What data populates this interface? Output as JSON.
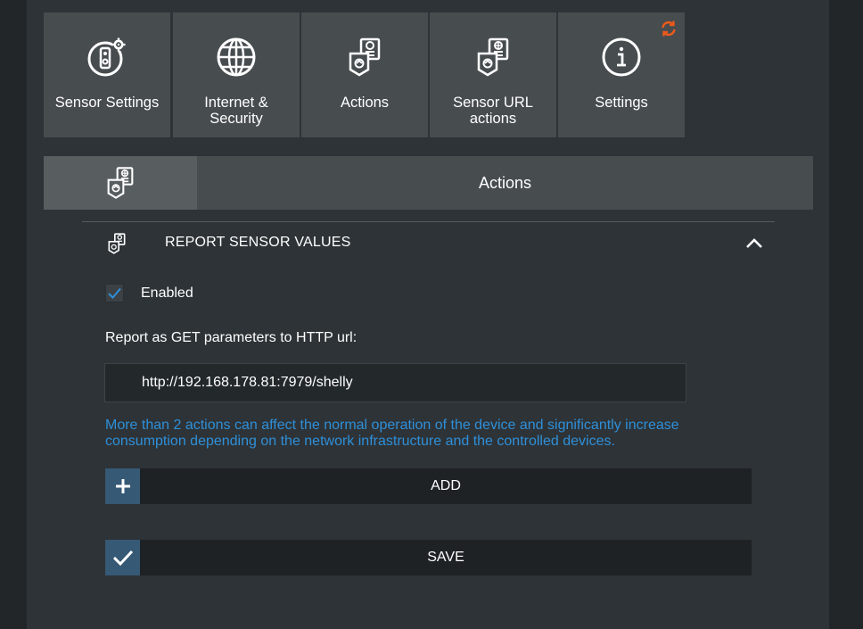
{
  "nav_tiles": [
    {
      "label": "Sensor Settings",
      "icon": "sensor-gear-icon"
    },
    {
      "label": "Internet & Security",
      "icon": "globe-icon"
    },
    {
      "label": "Actions",
      "icon": "actions-icon"
    },
    {
      "label": "Sensor URL actions",
      "icon": "sensor-url-actions-icon"
    },
    {
      "label": "Settings",
      "icon": "info-icon",
      "badge_icon": "refresh-icon"
    }
  ],
  "header": {
    "title": "Actions",
    "icon": "actions-icon"
  },
  "section": {
    "title": "REPORT SENSOR VALUES",
    "icon": "actions-icon",
    "toggle_icon": "chevron-up-icon",
    "enabled_checked": true,
    "enabled_label": "Enabled",
    "url_label": "Report as GET parameters to HTTP url:",
    "url_value": "http://192.168.178.81:7979/shelly",
    "warning": "More than 2 actions can affect the normal operation of the device and significantly increase consumption depending on the network infrastructure and the controlled devices."
  },
  "buttons": {
    "add_label": "ADD",
    "save_label": "SAVE"
  },
  "colors": {
    "accent_blue": "#2f8fd8",
    "button_icon_bg": "#365a75",
    "refresh_orange": "#e8591c",
    "tile_bg": "#474c4f"
  }
}
